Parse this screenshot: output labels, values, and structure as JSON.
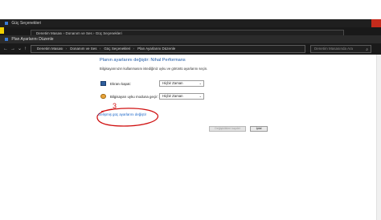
{
  "back_window": {
    "title": "Güç Seçenekleri",
    "breadcrumb": "Denetim Masası  ›  Donanım ve Ses  ›  Güç Seçenekleri"
  },
  "front_window": {
    "title": "Plan Ayarlarını Düzenle",
    "breadcrumb": [
      "Denetim Masası",
      "Donanım ve Ses",
      "Güç Seçenekleri",
      "Plan Ayarlarını Düzenle"
    ],
    "search_placeholder": "Denetim Masasında Ara"
  },
  "content": {
    "heading": "Planın ayarlarını değiştir: Nihal Performans",
    "description": "Bilgisayarınızın kullanmasını istediğiniz uyku ve görüntü ayarlarını seçin.",
    "rows": [
      {
        "label": "Ekranı kapat:",
        "value": "Hiçbir Zaman",
        "icon": "display-icon"
      },
      {
        "label": "Bilgisayarı uyku moduna geçir:",
        "value": "Hiçbir Zaman",
        "icon": "moon-icon"
      }
    ],
    "advanced_link": "Gelişmiş güç ayarlarını değiştir",
    "annotation_number": "3",
    "save_button": "Değişiklikleri kaydet",
    "cancel_button": "İptal"
  },
  "colors": {
    "annotation": "#d01010",
    "link": "#1a66c8",
    "heading": "#1e5aa8"
  }
}
